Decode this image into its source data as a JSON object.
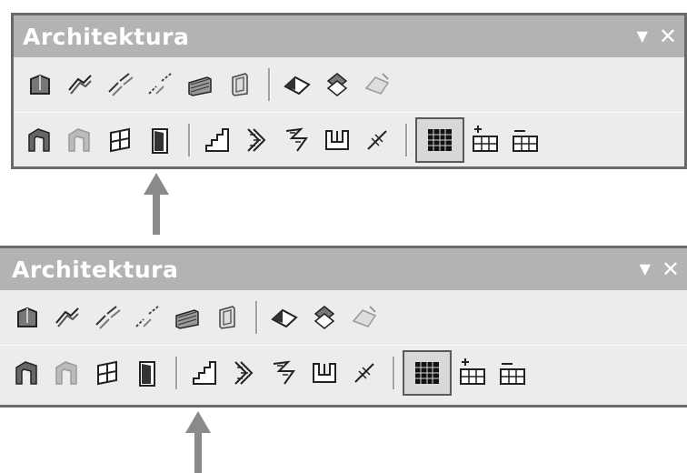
{
  "panels": [
    {
      "title": "Architektura"
    },
    {
      "title": "Architektura"
    }
  ],
  "icons": {
    "row1": [
      "wall-icon",
      "wall-join-icon",
      "wall-split-icon",
      "wall-break-icon",
      "wall-profile-icon",
      "wall-edit-icon",
      "roof-icon",
      "roof-edit-icon",
      "roof-disabled-icon"
    ],
    "row2": [
      "column-icon",
      "column-disabled-icon",
      "window-icon",
      "door-icon",
      "stairs-icon",
      "stairs-straight-icon",
      "stairs-spiral-icon",
      "railing-icon",
      "wall-cut-icon",
      "grid-icon",
      "add-row-icon",
      "remove-row-icon"
    ]
  },
  "colors": {
    "titlebar": "#b3b3b3",
    "toolbar": "#ececec",
    "arrow": "#8a8a8a"
  }
}
